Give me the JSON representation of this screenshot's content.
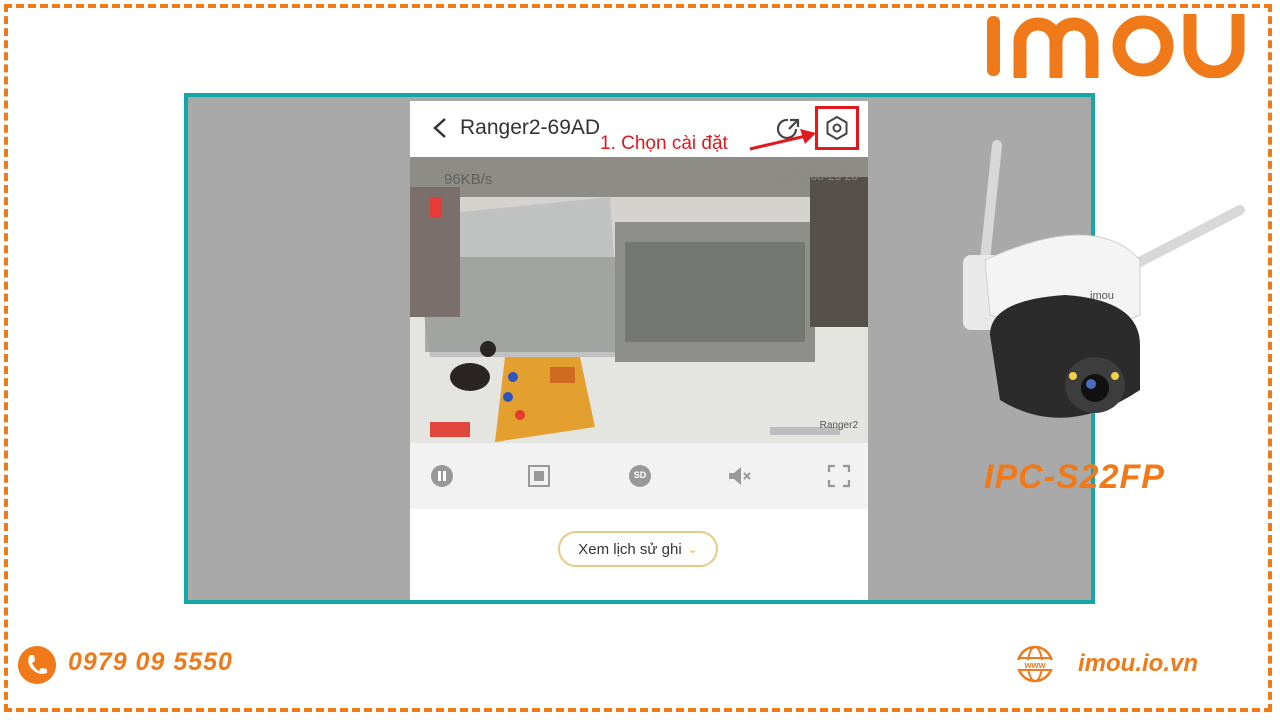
{
  "brand": {
    "logo_text": "imou",
    "accent": "#f07a1a",
    "frame_color": "#14a7a7"
  },
  "app": {
    "title": "Ranger2-69AD",
    "annotation": "1. Chọn cài đặt",
    "annotation_color": "#e0191f",
    "video": {
      "bitrate": "96KB/s",
      "timestamp": "2021-08-26 20",
      "camera_tag": "Ranger2"
    },
    "controls": [
      "pause-icon",
      "multiscreen-icon",
      "sd-quality-icon",
      "mute-icon",
      "fullscreen-icon"
    ],
    "sd_label": "SD",
    "playback_label": "Xem lịch sử ghi"
  },
  "product": {
    "model": "IPC-S22FP",
    "body_logo": "imou"
  },
  "footer": {
    "phone": "0979 09 5550",
    "website": "imou.io.vn"
  }
}
